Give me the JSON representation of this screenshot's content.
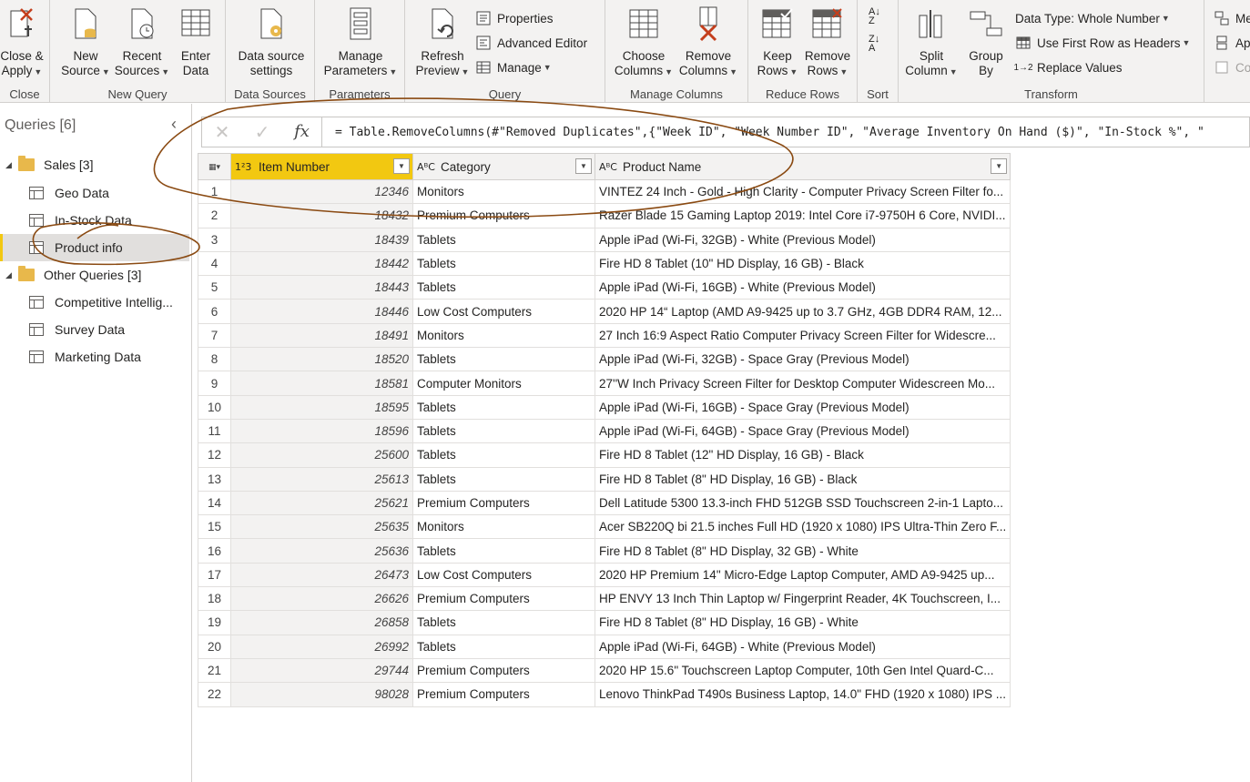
{
  "ribbon": {
    "groups": {
      "close": "Close",
      "new_query": "New Query",
      "data_sources": "Data Sources",
      "parameters": "Parameters",
      "query": "Query",
      "manage_columns": "Manage Columns",
      "reduce_rows": "Reduce Rows",
      "sort": "Sort",
      "transform": "Transform"
    },
    "buttons": {
      "close_apply_1": "Close &",
      "close_apply_2": "Apply",
      "new_source_1": "New",
      "new_source_2": "Source",
      "recent_sources_1": "Recent",
      "recent_sources_2": "Sources",
      "enter_data_1": "Enter",
      "enter_data_2": "Data",
      "ds_settings_1": "Data source",
      "ds_settings_2": "settings",
      "manage_params_1": "Manage",
      "manage_params_2": "Parameters",
      "refresh_preview_1": "Refresh",
      "refresh_preview_2": "Preview",
      "properties": "Properties",
      "advanced_editor": "Advanced Editor",
      "manage": "Manage",
      "choose_columns_1": "Choose",
      "choose_columns_2": "Columns",
      "remove_columns_1": "Remove",
      "remove_columns_2": "Columns",
      "keep_rows_1": "Keep",
      "keep_rows_2": "Rows",
      "remove_rows_1": "Remove",
      "remove_rows_2": "Rows",
      "split_column_1": "Split",
      "split_column_2": "Column",
      "group_by_1": "Group",
      "group_by_2": "By",
      "data_type": "Data Type: Whole Number",
      "first_row_headers": "Use First Row as Headers",
      "replace_values": "Replace Values",
      "extra_1": "Me",
      "extra_2": "Ap",
      "extra_3": "Co"
    }
  },
  "queries": {
    "header": "Queries [6]",
    "groups": [
      {
        "label": "Sales [3]",
        "items": [
          "Geo Data",
          "In-Stock Data",
          "Product info"
        ]
      },
      {
        "label": "Other Queries [3]",
        "items": [
          "Competitive Intellig...",
          "Survey Data",
          "Marketing Data"
        ]
      }
    ]
  },
  "formula": {
    "text": "= Table.RemoveColumns(#\"Removed Duplicates\",{\"Week ID\", \"Week Number ID\", \"Average Inventory On Hand ($)\", \"In-Stock %\", \""
  },
  "columns": [
    {
      "type": "1²3",
      "name": "Item Number"
    },
    {
      "type": "AᴮC",
      "name": "Category"
    },
    {
      "type": "AᴮC",
      "name": "Product Name"
    }
  ],
  "rows": [
    [
      "1",
      "12346",
      "Monitors",
      "VINTEZ 24 Inch - Gold - High Clarity - Computer Privacy Screen Filter fo..."
    ],
    [
      "2",
      "18432",
      "Premium Computers",
      "Razer Blade 15 Gaming Laptop 2019: Intel Core i7-9750H 6 Core, NVIDI..."
    ],
    [
      "3",
      "18439",
      "Tablets",
      "Apple iPad (Wi-Fi, 32GB) - White (Previous Model)"
    ],
    [
      "4",
      "18442",
      "Tablets",
      "Fire HD 8 Tablet (10\" HD Display, 16 GB) - Black"
    ],
    [
      "5",
      "18443",
      "Tablets",
      "Apple iPad (Wi-Fi, 16GB) - White (Previous Model)"
    ],
    [
      "6",
      "18446",
      "Low Cost Computers",
      "2020 HP 14“ Laptop (AMD A9-9425 up to 3.7 GHz, 4GB DDR4 RAM, 12..."
    ],
    [
      "7",
      "18491",
      "Monitors",
      "27 Inch 16:9 Aspect Ratio Computer Privacy Screen Filter for Widescre..."
    ],
    [
      "8",
      "18520",
      "Tablets",
      "Apple iPad (Wi-Fi, 32GB) - Space Gray (Previous Model)"
    ],
    [
      "9",
      "18581",
      "Computer Monitors",
      "27''W Inch Privacy Screen Filter for Desktop Computer Widescreen Mo..."
    ],
    [
      "10",
      "18595",
      "Tablets",
      "Apple iPad (Wi-Fi, 16GB) - Space Gray (Previous Model)"
    ],
    [
      "11",
      "18596",
      "Tablets",
      "Apple iPad (Wi-Fi, 64GB) - Space Gray (Previous Model)"
    ],
    [
      "12",
      "25600",
      "Tablets",
      "Fire HD 8 Tablet (12\" HD Display, 16 GB) - Black"
    ],
    [
      "13",
      "25613",
      "Tablets",
      "Fire HD 8 Tablet (8\" HD Display, 16 GB) - Black"
    ],
    [
      "14",
      "25621",
      "Premium Computers",
      "Dell Latitude 5300 13.3-inch FHD 512GB SSD Touchscreen 2-in-1 Lapto..."
    ],
    [
      "15",
      "25635",
      "Monitors",
      "Acer SB220Q bi 21.5 inches Full HD (1920 x 1080) IPS Ultra-Thin Zero F..."
    ],
    [
      "16",
      "25636",
      "Tablets",
      "Fire HD 8 Tablet (8\" HD Display, 32 GB) - White"
    ],
    [
      "17",
      "26473",
      "Low Cost Computers",
      "2020 HP Premium 14\" Micro-Edge Laptop Computer, AMD A9-9425 up..."
    ],
    [
      "18",
      "26626",
      "Premium Computers",
      "HP ENVY 13 Inch Thin Laptop w/ Fingerprint Reader, 4K Touchscreen, I..."
    ],
    [
      "19",
      "26858",
      "Tablets",
      "Fire HD 8 Tablet (8\" HD Display, 16 GB) - White"
    ],
    [
      "20",
      "26992",
      "Tablets",
      "Apple iPad (Wi-Fi, 64GB) - White (Previous Model)"
    ],
    [
      "21",
      "29744",
      "Premium Computers",
      "2020 HP 15.6\" Touchscreen Laptop Computer, 10th Gen Intel Quard-C..."
    ],
    [
      "22",
      "98028",
      "Premium Computers",
      "Lenovo ThinkPad T490s Business Laptop, 14.0\" FHD (1920 x 1080) IPS ..."
    ]
  ],
  "colors": {
    "accent": "#f2c811",
    "annotation": "#8a4a12"
  }
}
